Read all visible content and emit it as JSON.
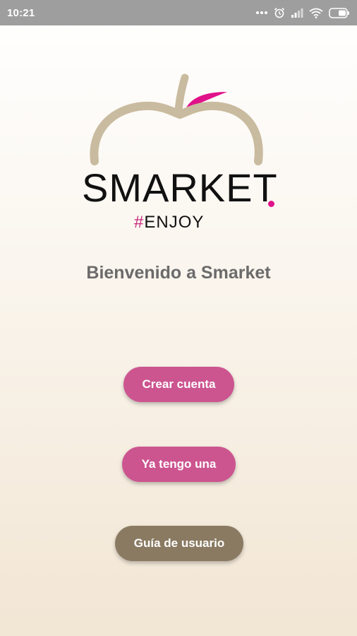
{
  "status_bar": {
    "time": "10:21",
    "icons": [
      "more-dots-icon",
      "alarm-icon",
      "signal-icon",
      "wifi-icon",
      "battery-icon"
    ]
  },
  "brand": {
    "name": "SMARKET",
    "tagline_hash": "#",
    "tagline": "ENJOY",
    "colors": {
      "apple": "#c9bb9f",
      "leaf": "#e0128a",
      "dot": "#e0128a",
      "text": "#111111"
    }
  },
  "welcome": {
    "title": "Bienvenido a Smarket"
  },
  "actions": {
    "create_account": "Crear cuenta",
    "have_account": "Ya tengo una",
    "user_guide": "Guía de usuario",
    "colors": {
      "primary": "#cc5590",
      "secondary": "#8a7a62"
    }
  }
}
